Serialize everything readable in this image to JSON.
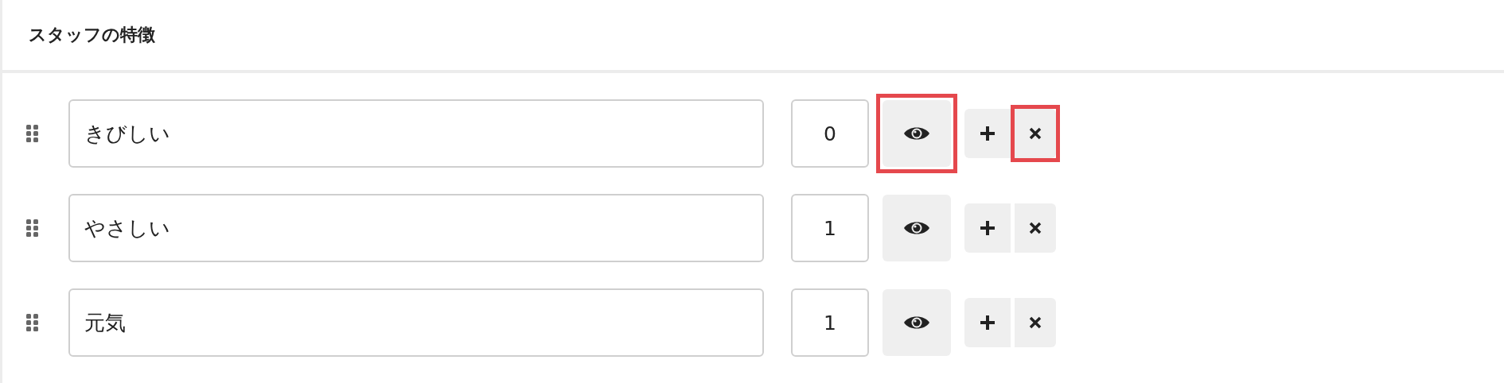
{
  "panel": {
    "title": "スタッフの特徴"
  },
  "rows": [
    {
      "name": "きびしい",
      "count": "0",
      "view_highlighted": true,
      "remove_highlighted": true
    },
    {
      "name": "やさしい",
      "count": "1",
      "view_highlighted": false,
      "remove_highlighted": false
    },
    {
      "name": "元気",
      "count": "1",
      "view_highlighted": false,
      "remove_highlighted": false
    }
  ]
}
